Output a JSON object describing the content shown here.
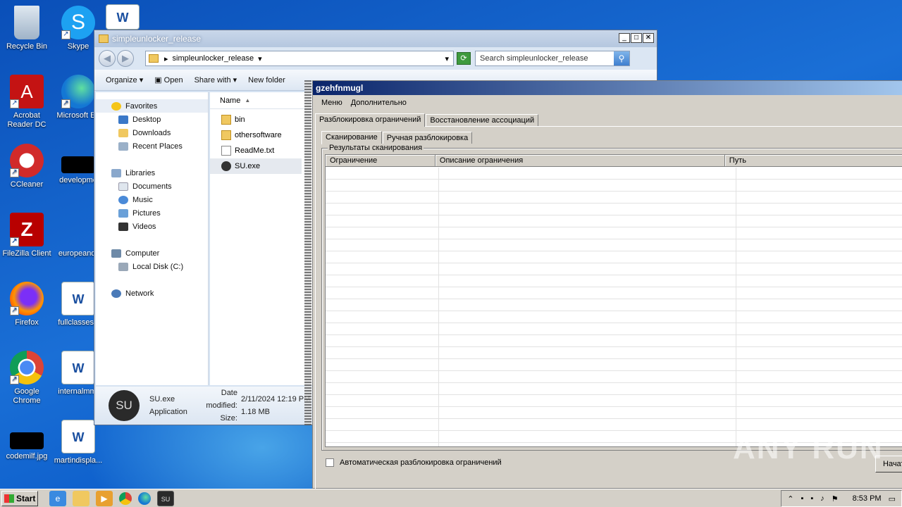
{
  "desktop": {
    "icons": [
      {
        "label": "Recycle Bin"
      },
      {
        "label": "Skype"
      },
      {
        "label": "Acrobat Reader DC"
      },
      {
        "label": "Microsoft Ed"
      },
      {
        "label": "CCleaner"
      },
      {
        "label": "developme"
      },
      {
        "label": "FileZilla Client"
      },
      {
        "label": "europeandr"
      },
      {
        "label": "Firefox"
      },
      {
        "label": "fullclasses.r"
      },
      {
        "label": "Google Chrome"
      },
      {
        "label": "internalmm."
      },
      {
        "label": "codemilf.jpg"
      },
      {
        "label": "martindispla..."
      }
    ]
  },
  "explorer": {
    "title": "simpleunlocker_release",
    "address": "simpleunlocker_release",
    "search_placeholder": "Search simpleunlocker_release",
    "toolbar": {
      "organize": "Organize",
      "open": "Open",
      "share_with": "Share with",
      "new_folder": "New folder"
    },
    "nav": {
      "favorites": "Favorites",
      "desktop": "Desktop",
      "downloads": "Downloads",
      "recent": "Recent Places",
      "libraries": "Libraries",
      "documents": "Documents",
      "music": "Music",
      "pictures": "Pictures",
      "videos": "Videos",
      "computer": "Computer",
      "local_disk": "Local Disk (C:)",
      "network": "Network"
    },
    "column_name": "Name",
    "files": [
      "bin",
      "othersoftware",
      "ReadMe.txt",
      "SU.exe"
    ],
    "details": {
      "name": "SU.exe",
      "type": "Application",
      "date_label": "Date modified:",
      "date_value": "2/11/2024 12:19 PM",
      "size_label": "Size:",
      "size_value": "1.18 MB"
    }
  },
  "unlocker": {
    "title": "gzehfnmugl",
    "menu": [
      "Меню",
      "Дополнительно"
    ],
    "tabs": [
      "Разблокировка ограничений",
      "Восстановление ассоциаций"
    ],
    "subtabs": [
      "Сканирование",
      "Ручная разблокировка"
    ],
    "group_title": "Результаты сканирования",
    "columns": [
      "Ограничение",
      "Описание ограничения",
      "Путь"
    ],
    "auto_unlock": "Автоматическая разблокировка ограничений",
    "start_button": "Начат"
  },
  "taskbar": {
    "start": "Start",
    "time": "8:53 PM"
  },
  "watermark": "ANY RUN",
  "colors": {
    "desktop": "#1a6fd6",
    "unlocker_title": "#0a246a",
    "classic_gray": "#d4d0c8"
  }
}
